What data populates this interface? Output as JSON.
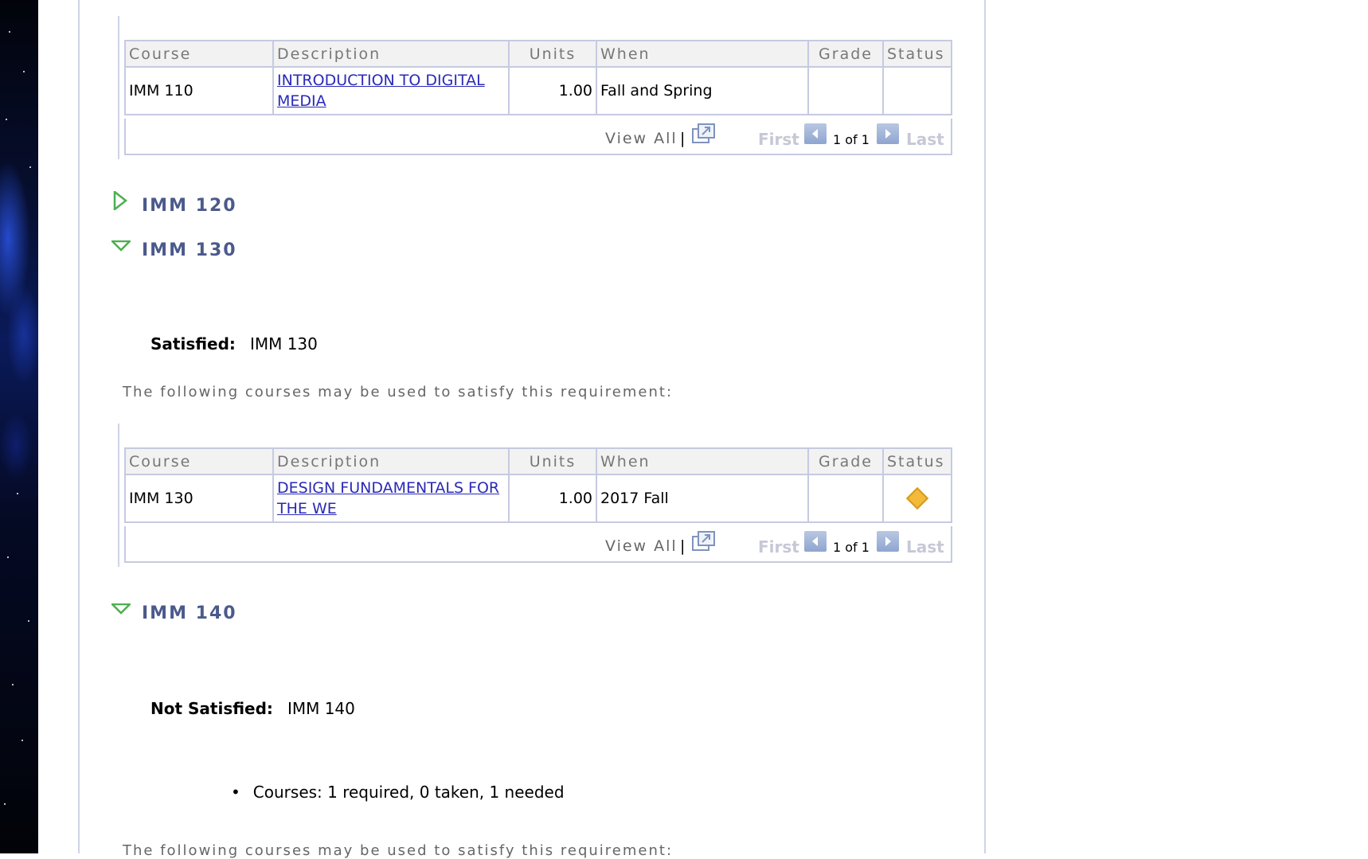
{
  "table_columns": [
    "Course",
    "Description",
    "Units",
    "When",
    "Grade",
    "Status"
  ],
  "table1": {
    "rows": [
      {
        "course": "IMM 110",
        "description": "INTRODUCTION TO DIGITAL MEDIA",
        "units": "1.00",
        "when": "Fall and Spring",
        "grade": "",
        "status": ""
      }
    ],
    "nav": {
      "view_all": "View All",
      "separator": "|",
      "first": "First",
      "count": "1 of 1",
      "last": "Last"
    }
  },
  "groups": [
    {
      "id": "imm120",
      "title": "IMM 120",
      "expanded": false
    },
    {
      "id": "imm130",
      "title": "IMM 130",
      "expanded": true
    },
    {
      "id": "imm140",
      "title": "IMM 140",
      "expanded": true
    }
  ],
  "imm130": {
    "status_label": "Satisfied:",
    "status_value": "IMM 130",
    "note": "The following courses may be used to satisfy this requirement:",
    "rows": [
      {
        "course": "IMM 130",
        "description": "DESIGN FUNDAMENTALS FOR THE WE",
        "units": "1.00",
        "when": "2017 Fall",
        "grade": "",
        "status_icon": "in-progress-diamond-icon"
      }
    ],
    "nav": {
      "view_all": "View All",
      "separator": "|",
      "first": "First",
      "count": "1 of 1",
      "last": "Last"
    }
  },
  "imm140": {
    "status_label": "Not Satisfied:",
    "status_value": "IMM 140",
    "bullet": "Courses: 1 required, 0 taken, 1 needed",
    "note": "The following courses may be used to satisfy this requirement:"
  },
  "colors": {
    "link": "#2a2ab8",
    "header_text": "#4b5a8c",
    "status_diamond": "#f2b93a",
    "expand_triangle": "#4caf50"
  }
}
